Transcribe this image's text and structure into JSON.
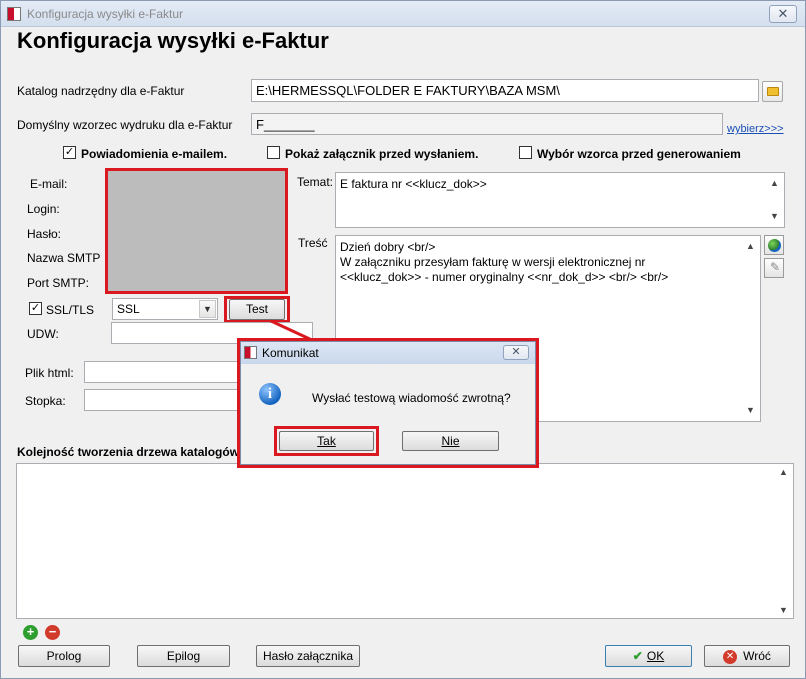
{
  "window": {
    "title": "Konfiguracja wysyłki e-Faktur"
  },
  "heading": "Konfiguracja wysyłki e-Faktur",
  "catalog": {
    "label": "Katalog nadrzędny dla e-Faktur",
    "value": "E:\\HERMESSQL\\FOLDER E FAKTURY\\BAZA MSM\\"
  },
  "template": {
    "label": "Domyślny wzorzec wydruku dla e-Faktur",
    "value": "F_______",
    "choose_link": "wybierz>>>"
  },
  "checks": {
    "email_notify": {
      "label": "Powiadomienia e-mailem.",
      "checked": true
    },
    "show_attachment": {
      "label": "Pokaż załącznik przed wysłaniem.",
      "checked": false
    },
    "choose_template": {
      "label": "Wybór wzorca przed generowaniem",
      "checked": false
    }
  },
  "smtp": {
    "email_label": "E-mail:",
    "login_label": "Login:",
    "password_label": "Hasło:",
    "smtp_name_label": "Nazwa SMTP",
    "smtp_port_label": "Port SMTP:",
    "ssl_label": "SSL/TLS",
    "ssl_checked": true,
    "ssl_value": "SSL",
    "test_button": "Test",
    "udw_label": "UDW:"
  },
  "html_file_label": "Plik html:",
  "footer_label": "Stopka:",
  "subject": {
    "label": "Temat:",
    "value": "E faktura  nr <<klucz_dok>>"
  },
  "body": {
    "label": "Treść",
    "lines": [
      "Dzień dobry <br/>",
      "W załączniku przesyłam fakturę w wersji elektronicznej nr",
      "<<klucz_dok>> - numer oryginalny <<nr_dok_d>> <br/> <br/>"
    ]
  },
  "tree_order": {
    "label": "Kolejność tworzenia drzewa katalogów"
  },
  "dialog": {
    "title": "Komunikat",
    "message": "Wysłać testową wiadomość zwrotną?",
    "yes": "Tak",
    "no": "Nie"
  },
  "bottom": {
    "prolog": "Prolog",
    "epilog": "Epilog",
    "attachment_password": "Hasło załącznika",
    "ok": "OK",
    "back": "Wróć"
  },
  "colors": {
    "highlight": "#d9191f",
    "link": "#1a4fb5"
  }
}
